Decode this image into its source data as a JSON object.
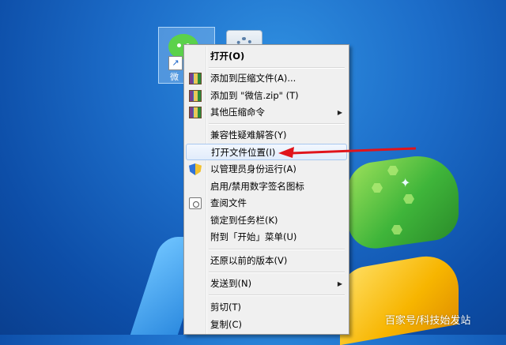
{
  "desktop": {
    "wechat_icon_label_fragment": "微"
  },
  "context_menu": {
    "items": [
      {
        "label": "打开(O)",
        "bold": true,
        "icon": ""
      },
      {
        "label": "添加到压缩文件(A)...",
        "icon": "winrar-icon"
      },
      {
        "label": "添加到 \"微信.zip\" (T)",
        "icon": "winrar-icon"
      },
      {
        "label": "其他压缩命令",
        "icon": "winrar-icon",
        "submenu": true
      },
      {
        "label": "兼容性疑难解答(Y)",
        "icon": ""
      },
      {
        "label": "打开文件位置(I)",
        "icon": "",
        "highlighted": true
      },
      {
        "label": "以管理员身份运行(A)",
        "icon": "uac-shield-icon"
      },
      {
        "label": "启用/禁用数字签名图标",
        "icon": ""
      },
      {
        "label": "查阅文件",
        "icon": "scan-file-icon"
      },
      {
        "label": "锁定到任务栏(K)",
        "icon": ""
      },
      {
        "label": "附到「开始」菜单(U)",
        "icon": ""
      },
      {
        "label": "还原以前的版本(V)",
        "icon": ""
      },
      {
        "label": "发送到(N)",
        "icon": "",
        "submenu": true
      },
      {
        "label": "剪切(T)",
        "icon": ""
      },
      {
        "label": "复制(C)",
        "icon": ""
      }
    ],
    "submenu_glyph": "▶"
  },
  "annotation": {
    "color": "#e0141b"
  },
  "watermark": "百家号/科技始发站"
}
